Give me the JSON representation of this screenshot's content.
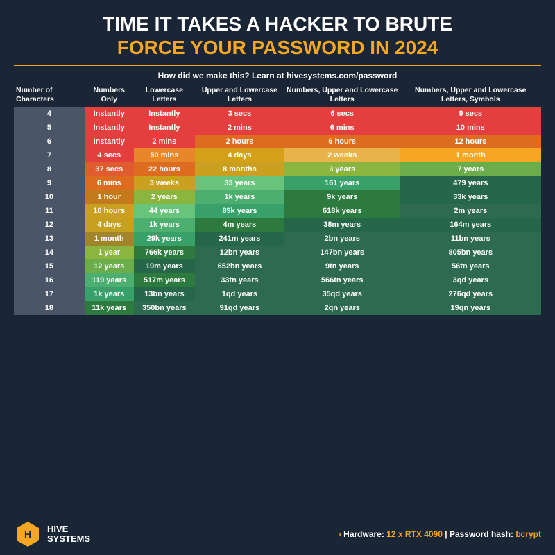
{
  "title": {
    "line1": "TIME IT TAKES A HACKER TO BRUTE",
    "line2": "FORCE YOUR PASSWORD IN ",
    "year": "2024"
  },
  "subtitle": "How did we make this? Learn at hivesystems.com/password",
  "headers": [
    "Number of Characters",
    "Numbers Only",
    "Lowercase Letters",
    "Upper and Lowercase Letters",
    "Numbers, Upper and Lowercase Letters",
    "Numbers, Upper and Lowercase Letters, Symbols"
  ],
  "rows": [
    {
      "chars": "4",
      "cols": [
        "Instantly",
        "Instantly",
        "3 secs",
        "6 secs",
        "9 secs"
      ]
    },
    {
      "chars": "5",
      "cols": [
        "Instantly",
        "Instantly",
        "2 mins",
        "6 mins",
        "10 mins"
      ]
    },
    {
      "chars": "6",
      "cols": [
        "Instantly",
        "2 mins",
        "2 hours",
        "6 hours",
        "12 hours"
      ]
    },
    {
      "chars": "7",
      "cols": [
        "4 secs",
        "50 mins",
        "4 days",
        "2 weeks",
        "1 month"
      ]
    },
    {
      "chars": "8",
      "cols": [
        "37 secs",
        "22 hours",
        "8 months",
        "3 years",
        "7 years"
      ]
    },
    {
      "chars": "9",
      "cols": [
        "6 mins",
        "3 weeks",
        "33 years",
        "161 years",
        "479 years"
      ]
    },
    {
      "chars": "10",
      "cols": [
        "1 hour",
        "2 years",
        "1k years",
        "9k years",
        "33k years"
      ]
    },
    {
      "chars": "11",
      "cols": [
        "10 hours",
        "44 years",
        "89k years",
        "618k years",
        "2m years"
      ]
    },
    {
      "chars": "12",
      "cols": [
        "4 days",
        "1k years",
        "4m years",
        "38m years",
        "164m years"
      ]
    },
    {
      "chars": "13",
      "cols": [
        "1 month",
        "29k years",
        "241m years",
        "2bn years",
        "11bn years"
      ]
    },
    {
      "chars": "14",
      "cols": [
        "1 year",
        "766k years",
        "12bn years",
        "147bn years",
        "805bn years"
      ]
    },
    {
      "chars": "15",
      "cols": [
        "12 years",
        "19m years",
        "652bn years",
        "9tn years",
        "56tn years"
      ]
    },
    {
      "chars": "16",
      "cols": [
        "119 years",
        "517m years",
        "33tn years",
        "566tn years",
        "3qd years"
      ]
    },
    {
      "chars": "17",
      "cols": [
        "1k years",
        "13bn years",
        "1qd years",
        "35qd years",
        "276qd years"
      ]
    },
    {
      "chars": "18",
      "cols": [
        "11k years",
        "350bn years",
        "91qd years",
        "2qn years",
        "19qn years"
      ]
    }
  ],
  "footer": {
    "logo_text": "HIVE\nSYSTEMS",
    "hardware_label": "Hardware: ",
    "hardware_value": "12 x RTX 4090",
    "separator": " | ",
    "hash_label": "Password hash: ",
    "hash_value": "bcrypt"
  }
}
